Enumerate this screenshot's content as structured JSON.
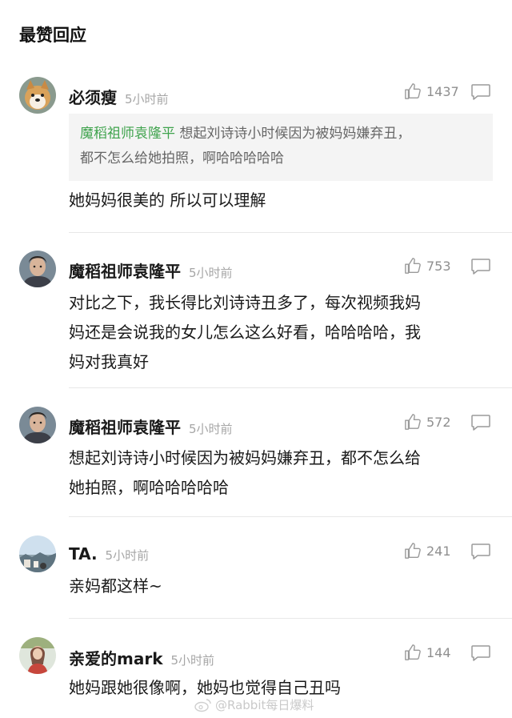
{
  "section_title": "最赞回应",
  "comments": [
    {
      "name": "必须瘦",
      "time": "5小时前",
      "likes": "1437",
      "quote": {
        "author": "魔稻祖师袁隆平",
        "text_line1": "想起刘诗诗小时候因为被妈妈嫌弃丑，",
        "text_line2": "都不怎么给她拍照，啊哈哈哈哈哈"
      },
      "text": "她妈妈很美的 所以可以理解",
      "avatar": "shiba-dog-avatar"
    },
    {
      "name": "魔稻祖师袁隆平",
      "time": "5小时前",
      "likes": "753",
      "text_lines": [
        "对比之下，我长得比刘诗诗丑多了，每次视频我妈",
        "妈还是会说我的女儿怎么这么好看，哈哈哈哈，我",
        "妈对我真好"
      ],
      "avatar": "man-portrait-avatar"
    },
    {
      "name": "魔稻祖师袁隆平",
      "time": "5小时前",
      "likes": "572",
      "text_lines": [
        "想起刘诗诗小时候因为被妈妈嫌弃丑，都不怎么给",
        "她拍照，啊哈哈哈哈哈"
      ],
      "avatar": "man-portrait-avatar"
    },
    {
      "name": "TA.",
      "time": "5小时前",
      "likes": "241",
      "text": "亲妈都这样~",
      "avatar": "landscape-avatar"
    },
    {
      "name": "亲爱的mark",
      "time": "5小时前",
      "likes": "144",
      "text": "她妈跟她很像啊，她妈也觉得自己丑吗",
      "avatar": "girl-avatar"
    }
  ],
  "watermark": "@Rabbit每日爆料",
  "colors": {
    "quote_author": "#3fa34d",
    "meta_gray": "#a6a6a6",
    "quote_bg": "#f4f4f4"
  }
}
